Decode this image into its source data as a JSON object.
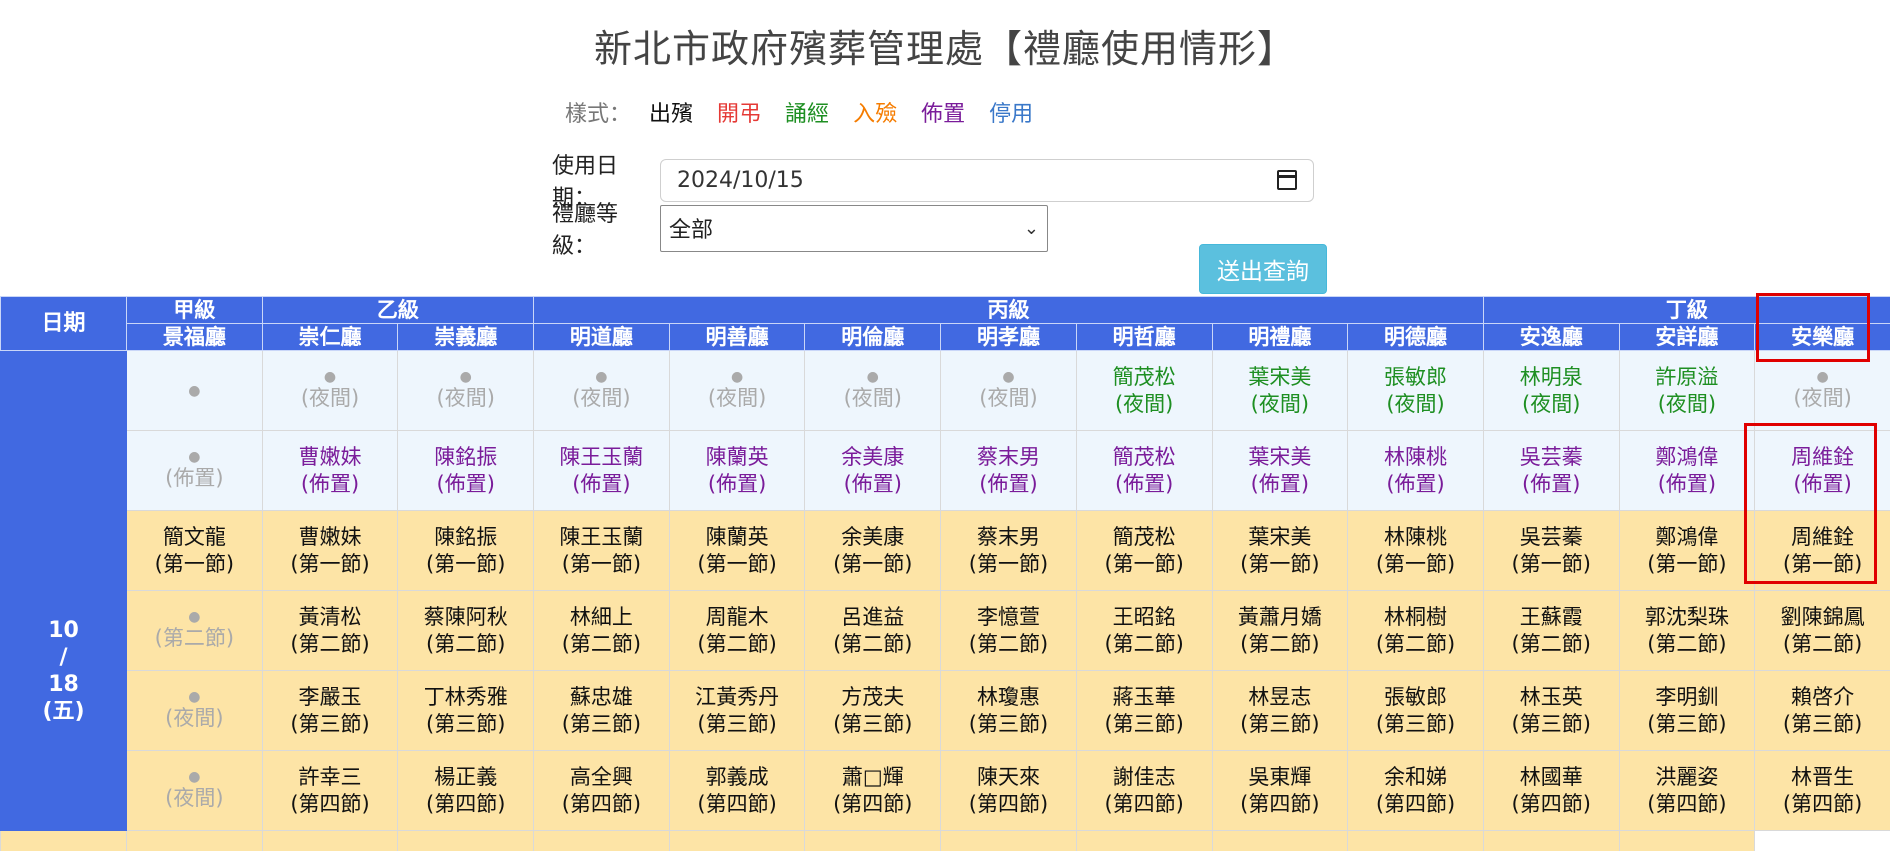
{
  "title": "新北市政府殯葬管理處【禮廳使用情形】",
  "legend": {
    "label": "樣式：",
    "items": [
      {
        "text": "出殯",
        "color": "#111111"
      },
      {
        "text": "開弔",
        "color": "#e53935"
      },
      {
        "text": "誦經",
        "color": "#1e8f22"
      },
      {
        "text": "入殮",
        "color": "#f57c00"
      },
      {
        "text": "佈置",
        "color": "#7a1c9a"
      },
      {
        "text": "停用",
        "color": "#3a78c9"
      }
    ]
  },
  "form": {
    "date_label": "使用日期：",
    "date_value": "2024/10/15",
    "level_label": "禮廳等級：",
    "level_value": "全部",
    "submit_label": "送出查詢"
  },
  "table": {
    "date_header": "日期",
    "grades": [
      {
        "name": "甲級",
        "span": 1
      },
      {
        "name": "乙級",
        "span": 2
      },
      {
        "name": "丙級",
        "span": 7
      },
      {
        "name": "丁級",
        "span": 3
      }
    ],
    "halls": [
      "景福廳",
      "崇仁廳",
      "崇義廳",
      "明道廳",
      "明善廳",
      "明倫廳",
      "明孝廳",
      "明哲廳",
      "明禮廳",
      "明德廳",
      "安逸廳",
      "安詳廳",
      "安樂廳"
    ],
    "date_cell": {
      "month": "10",
      "sep": "/",
      "day": "18",
      "weekday": "(五)"
    },
    "rows": [
      {
        "type": "night",
        "cells": [
          {
            "empty": true,
            "name": "",
            "label": ""
          },
          {
            "empty": true,
            "name": "",
            "label": "(夜間)"
          },
          {
            "empty": true,
            "name": "",
            "label": "(夜間)"
          },
          {
            "empty": true,
            "name": "",
            "label": "(夜間)"
          },
          {
            "empty": true,
            "name": "",
            "label": "(夜間)"
          },
          {
            "empty": true,
            "name": "",
            "label": "(夜間)"
          },
          {
            "empty": true,
            "name": "",
            "label": "(夜間)"
          },
          {
            "empty": false,
            "name": "簡茂松",
            "label": "(夜間)",
            "color": "green"
          },
          {
            "empty": false,
            "name": "葉宋美",
            "label": "(夜間)",
            "color": "green"
          },
          {
            "empty": false,
            "name": "張敏郎",
            "label": "(夜間)",
            "color": "green"
          },
          {
            "empty": false,
            "name": "林明泉",
            "label": "(夜間)",
            "color": "green"
          },
          {
            "empty": false,
            "name": "許原溢",
            "label": "(夜間)",
            "color": "green"
          },
          {
            "empty": true,
            "name": "",
            "label": "(夜間)"
          }
        ]
      },
      {
        "type": "decor",
        "cells": [
          {
            "empty": true,
            "name": "",
            "label": "(佈置)"
          },
          {
            "empty": false,
            "name": "曹嫩妹",
            "label": "(佈置)",
            "color": "purple"
          },
          {
            "empty": false,
            "name": "陳銘振",
            "label": "(佈置)",
            "color": "purple"
          },
          {
            "empty": false,
            "name": "陳王玉蘭",
            "label": "(佈置)",
            "color": "purple"
          },
          {
            "empty": false,
            "name": "陳蘭英",
            "label": "(佈置)",
            "color": "purple"
          },
          {
            "empty": false,
            "name": "余美康",
            "label": "(佈置)",
            "color": "purple"
          },
          {
            "empty": false,
            "name": "蔡末男",
            "label": "(佈置)",
            "color": "purple"
          },
          {
            "empty": false,
            "name": "簡茂松",
            "label": "(佈置)",
            "color": "purple"
          },
          {
            "empty": false,
            "name": "葉宋美",
            "label": "(佈置)",
            "color": "purple"
          },
          {
            "empty": false,
            "name": "林陳桃",
            "label": "(佈置)",
            "color": "purple"
          },
          {
            "empty": false,
            "name": "吳芸蓁",
            "label": "(佈置)",
            "color": "purple"
          },
          {
            "empty": false,
            "name": "鄭鴻偉",
            "label": "(佈置)",
            "color": "purple"
          },
          {
            "empty": false,
            "name": "周維銓",
            "label": "(佈置)",
            "color": "purple"
          }
        ]
      },
      {
        "type": "session",
        "cells": [
          {
            "empty": false,
            "name": "簡文龍",
            "label": "(第一節)",
            "color": "black"
          },
          {
            "empty": false,
            "name": "曹嫩妹",
            "label": "(第一節)",
            "color": "black"
          },
          {
            "empty": false,
            "name": "陳銘振",
            "label": "(第一節)",
            "color": "black"
          },
          {
            "empty": false,
            "name": "陳王玉蘭",
            "label": "(第一節)",
            "color": "black"
          },
          {
            "empty": false,
            "name": "陳蘭英",
            "label": "(第一節)",
            "color": "black"
          },
          {
            "empty": false,
            "name": "余美康",
            "label": "(第一節)",
            "color": "black"
          },
          {
            "empty": false,
            "name": "蔡末男",
            "label": "(第一節)",
            "color": "black"
          },
          {
            "empty": false,
            "name": "簡茂松",
            "label": "(第一節)",
            "color": "black"
          },
          {
            "empty": false,
            "name": "葉宋美",
            "label": "(第一節)",
            "color": "black"
          },
          {
            "empty": false,
            "name": "林陳桃",
            "label": "(第一節)",
            "color": "black"
          },
          {
            "empty": false,
            "name": "吳芸蓁",
            "label": "(第一節)",
            "color": "black"
          },
          {
            "empty": false,
            "name": "鄭鴻偉",
            "label": "(第一節)",
            "color": "black"
          },
          {
            "empty": false,
            "name": "周維銓",
            "label": "(第一節)",
            "color": "black"
          }
        ]
      },
      {
        "type": "session",
        "cells": [
          {
            "empty": true,
            "name": "",
            "label": "(第二節)"
          },
          {
            "empty": false,
            "name": "黃清松",
            "label": "(第二節)",
            "color": "black"
          },
          {
            "empty": false,
            "name": "蔡陳阿秋",
            "label": "(第二節)",
            "color": "black"
          },
          {
            "empty": false,
            "name": "林細上",
            "label": "(第二節)",
            "color": "black"
          },
          {
            "empty": false,
            "name": "周龍木",
            "label": "(第二節)",
            "color": "black"
          },
          {
            "empty": false,
            "name": "呂進益",
            "label": "(第二節)",
            "color": "black"
          },
          {
            "empty": false,
            "name": "李憶萱",
            "label": "(第二節)",
            "color": "black"
          },
          {
            "empty": false,
            "name": "王昭銘",
            "label": "(第二節)",
            "color": "black"
          },
          {
            "empty": false,
            "name": "黃蕭月嬌",
            "label": "(第二節)",
            "color": "black"
          },
          {
            "empty": false,
            "name": "林桐樹",
            "label": "(第二節)",
            "color": "black"
          },
          {
            "empty": false,
            "name": "王蘇霞",
            "label": "(第二節)",
            "color": "black"
          },
          {
            "empty": false,
            "name": "郭沈梨珠",
            "label": "(第二節)",
            "color": "black"
          },
          {
            "empty": false,
            "name": "劉陳錦鳳",
            "label": "(第二節)",
            "color": "black"
          }
        ]
      },
      {
        "type": "session",
        "cells": [
          {
            "empty": true,
            "name": "",
            "label": "(夜間)"
          },
          {
            "empty": false,
            "name": "李嚴玉",
            "label": "(第三節)",
            "color": "black"
          },
          {
            "empty": false,
            "name": "丁林秀雅",
            "label": "(第三節)",
            "color": "black"
          },
          {
            "empty": false,
            "name": "蘇忠雄",
            "label": "(第三節)",
            "color": "black"
          },
          {
            "empty": false,
            "name": "江黃秀丹",
            "label": "(第三節)",
            "color": "black"
          },
          {
            "empty": false,
            "name": "方茂夫",
            "label": "(第三節)",
            "color": "black"
          },
          {
            "empty": false,
            "name": "林瓊惠",
            "label": "(第三節)",
            "color": "black"
          },
          {
            "empty": false,
            "name": "蔣玉華",
            "label": "(第三節)",
            "color": "black"
          },
          {
            "empty": false,
            "name": "林昱志",
            "label": "(第三節)",
            "color": "black"
          },
          {
            "empty": false,
            "name": "張敏郎",
            "label": "(第三節)",
            "color": "black"
          },
          {
            "empty": false,
            "name": "林玉英",
            "label": "(第三節)",
            "color": "black"
          },
          {
            "empty": false,
            "name": "李明釧",
            "label": "(第三節)",
            "color": "black"
          },
          {
            "empty": false,
            "name": "賴啓介",
            "label": "(第三節)",
            "color": "black"
          }
        ]
      },
      {
        "type": "session",
        "cells": [
          {
            "empty": true,
            "name": "",
            "label": "(夜間)"
          },
          {
            "empty": false,
            "name": "許幸三",
            "label": "(第四節)",
            "color": "black"
          },
          {
            "empty": false,
            "name": "楊正義",
            "label": "(第四節)",
            "color": "black"
          },
          {
            "empty": false,
            "name": "高全興",
            "label": "(第四節)",
            "color": "black"
          },
          {
            "empty": false,
            "name": "郭義成",
            "label": "(第四節)",
            "color": "black"
          },
          {
            "empty": false,
            "name": "蕭□輝",
            "label": "(第四節)",
            "color": "black"
          },
          {
            "empty": false,
            "name": "陳天來",
            "label": "(第四節)",
            "color": "black"
          },
          {
            "empty": false,
            "name": "謝佳志",
            "label": "(第四節)",
            "color": "black"
          },
          {
            "empty": false,
            "name": "吳東輝",
            "label": "(第四節)",
            "color": "black"
          },
          {
            "empty": false,
            "name": "余和娣",
            "label": "(第四節)",
            "color": "black"
          },
          {
            "empty": false,
            "name": "林國華",
            "label": "(第四節)",
            "color": "black"
          },
          {
            "empty": false,
            "name": "洪麗姿",
            "label": "(第四節)",
            "color": "black"
          },
          {
            "empty": false,
            "name": "林晋生",
            "label": "(第四節)",
            "color": "black"
          }
        ]
      }
    ]
  },
  "highlight_color": "#e00000"
}
